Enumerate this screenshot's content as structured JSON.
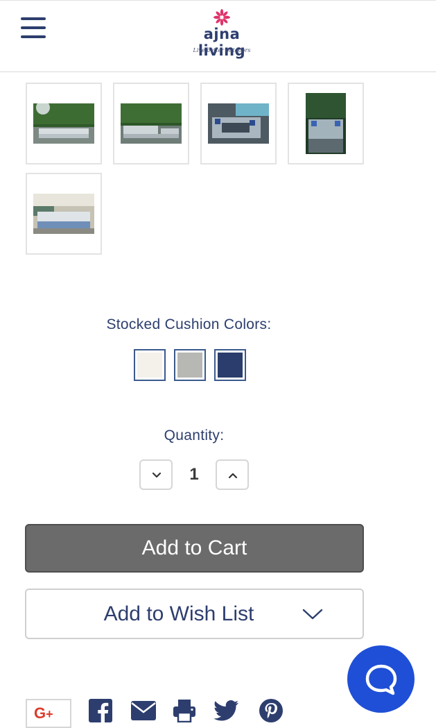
{
  "header": {
    "logo_name": "ajna living",
    "logo_tagline": "Live better outdoors",
    "menu_icon": "hamburger-menu-icon",
    "logo_color": "#e0336b"
  },
  "gallery": {
    "thumbnails": [
      {
        "alt": "outdoor sofa on patio with hedge"
      },
      {
        "alt": "outdoor sectional with hedge"
      },
      {
        "alt": "sectional by pool"
      },
      {
        "alt": "sectional portrait view"
      },
      {
        "alt": "sectional by pool evening"
      }
    ]
  },
  "colors": {
    "label": "Stocked Cushion Colors:",
    "swatches": [
      {
        "name": "white",
        "color": "#f3f1ea"
      },
      {
        "name": "grey",
        "color": "#b7b7b4"
      },
      {
        "name": "navy",
        "color": "#2b3d6c"
      }
    ]
  },
  "quantity": {
    "label": "Quantity:",
    "value": "1"
  },
  "actions": {
    "add_to_cart": "Add to Cart",
    "add_to_wishlist": "Add to Wish List"
  },
  "share": {
    "google_plus": "G",
    "google_plus_sup": "+",
    "icons": [
      "facebook-icon",
      "email-icon",
      "print-icon",
      "twitter-icon",
      "pinterest-icon"
    ]
  },
  "theme": {
    "primary": "#2d3e6e",
    "cart_bg": "#6b6b6b",
    "chat_bg": "#1f4fd6"
  }
}
